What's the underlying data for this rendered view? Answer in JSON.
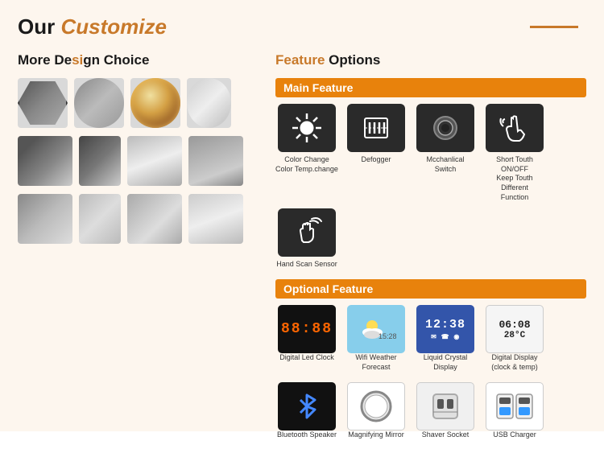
{
  "header": {
    "title_our": "Our ",
    "title_customize": "Customize"
  },
  "left_section": {
    "title_plain": "More De",
    "title_highlight": "si",
    "title_rest": "gn Choice"
  },
  "right_section": {
    "title_highlight": "Feature",
    "title_rest": " Options",
    "main_feature_label": "Main Feature",
    "optional_feature_label": "Optional Feature",
    "main_features": [
      {
        "label": "Color Change\nColor Temp.change",
        "icon": "sun-icon"
      },
      {
        "label": "Defogger",
        "icon": "defogger-icon"
      },
      {
        "label": "Mechanical\nSwitch",
        "icon": "switch-icon"
      },
      {
        "label": "Short Touch ON/OFF\nKeep Touch Different\nFunction",
        "icon": "touch-icon"
      },
      {
        "label": "Hand Scan Sensor",
        "icon": "hand-icon"
      }
    ],
    "optional_features_row1": [
      {
        "label": "Digital Led Clock",
        "icon": "led-clock-icon"
      },
      {
        "label": "Wifi Weather Forecast",
        "icon": "weather-icon"
      },
      {
        "label": "Liquid Crystal Display",
        "icon": "lcd-icon"
      },
      {
        "label": "Digital Display\n(clock & temp)",
        "icon": "digital-display-icon"
      }
    ],
    "optional_features_row2": [
      {
        "label": "Bluetooth Speaker",
        "icon": "bluetooth-icon"
      },
      {
        "label": "Magnifying Mirror",
        "icon": "magnifying-icon"
      },
      {
        "label": "Shaver Socket",
        "icon": "shaver-icon"
      },
      {
        "label": "USB Charger",
        "icon": "usb-icon"
      }
    ]
  }
}
